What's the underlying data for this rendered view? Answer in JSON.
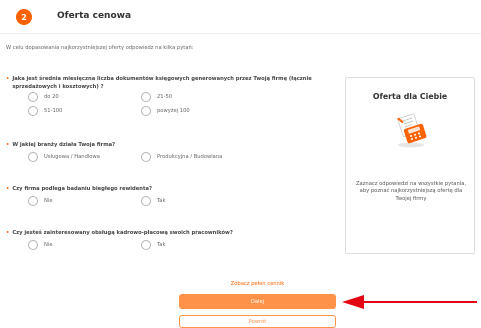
{
  "step": {
    "number": "2",
    "title": "Oferta cenowa"
  },
  "intro": "W celu dopasowania najkorzystniejszej oferty odpowiedz na kilka pytań:",
  "questions": [
    {
      "text": "Jaka jest średnia miesięczna liczba dokumentów księgowych generowanych przez Twoją firmę (łącznie sprzedażowych i kosztowych) ?",
      "options": [
        "do 20",
        "21-50",
        "51-100",
        "powyżej 100"
      ]
    },
    {
      "text": "W jakiej branży działa Twoja firma?",
      "options": [
        "Usługowa / Handlowa",
        "Produkcyjna / Budowlana"
      ]
    },
    {
      "text": "Czy firma podlega badaniu biegłego rewidenta?",
      "options": [
        "Nie",
        "Tak"
      ]
    },
    {
      "text": "Czy jesteś zainteresowany obsługą kadrowo-płacową swoich pracowników?",
      "options": [
        "Nie",
        "Tak"
      ]
    }
  ],
  "offer": {
    "title": "Oferta dla Ciebie",
    "text": "Zaznacz odpowiedzi na wszystkie pytania, aby poznać najkorzystniejszą ofertę dla Twojej firmy",
    "icon": "calculator-receipt-icon"
  },
  "actions": {
    "cennik": "Zobacz pełen cennik",
    "next": "Dalej",
    "back": "Powrót"
  },
  "colors": {
    "accent": "#ff6200",
    "button": "#ff9249",
    "arrow": "#e30613"
  }
}
